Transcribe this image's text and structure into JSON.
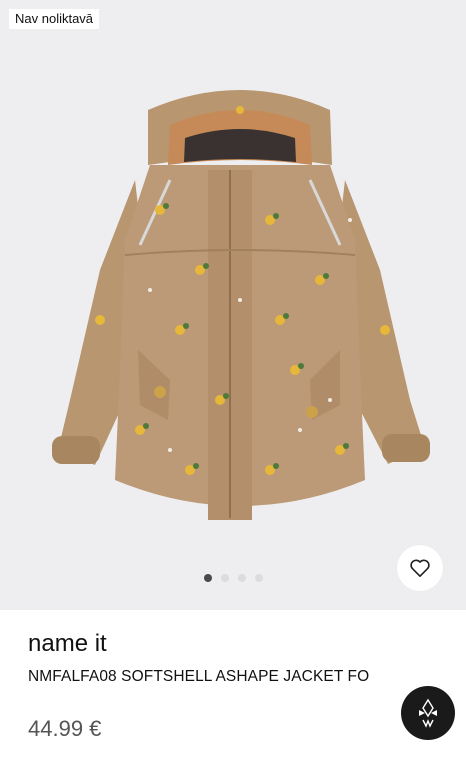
{
  "gallery": {
    "badge": "Nav noliktavā",
    "image_alt": "Softshell jacket with lemon print",
    "dots_total": 4,
    "active_index": 0,
    "favorite_icon": "heart-outline-icon"
  },
  "product": {
    "brand": "name it",
    "name": "NMFALFA08 SOFTSHELL ASHAPE JACKET FO",
    "price": "44.99 €"
  },
  "assistant": {
    "icon": "assistant-logo-icon"
  },
  "colors": {
    "jacket": "#bc9a78",
    "lining": "#c58a57",
    "background": "#eeeef0"
  }
}
